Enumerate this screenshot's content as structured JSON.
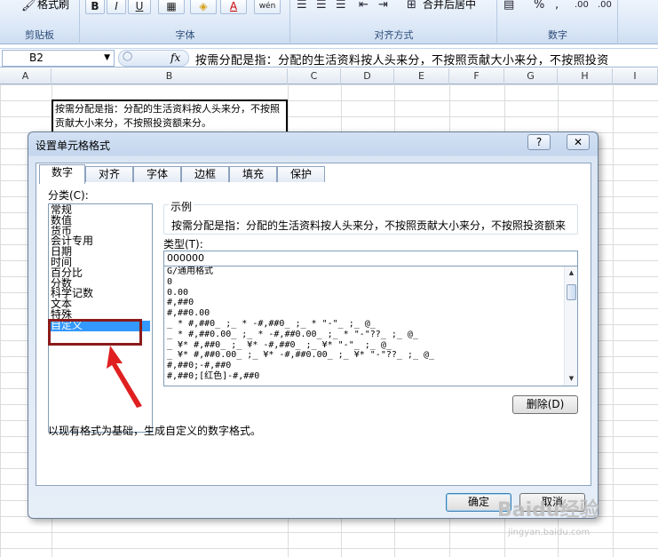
{
  "ribbon": {
    "format_painter_label": "格式刷",
    "clipboard_group": "剪贴板",
    "font_group": "字体",
    "alignment_group": "对齐方式",
    "number_group": "数字",
    "bold": "B",
    "italic": "I",
    "underline": "U",
    "merge_center": "合并后居中",
    "percent": "%",
    "comma": ",",
    "inc_decimal": ".00",
    "dec_decimal": ".00"
  },
  "formula_bar": {
    "name_box": "B2",
    "fx": "fx",
    "content": "按需分配是指：分配的生活资料按人头来分，不按照贡献大小来分，不按照投资"
  },
  "sheet": {
    "columns": [
      "A",
      "B",
      "C",
      "D",
      "E",
      "F",
      "G",
      "H",
      "I"
    ],
    "cell_b2_text": "按需分配是指：分配的生活资料按人头来分，不按照贡献大小来分，不按照投资额来分。"
  },
  "dialog": {
    "title": "设置单元格格式",
    "help": "?",
    "close": "✕",
    "tabs": [
      "数字",
      "对齐",
      "字体",
      "边框",
      "填充",
      "保护"
    ],
    "category_label": "分类(C):",
    "categories": [
      "常规",
      "数值",
      "货币",
      "会计专用",
      "日期",
      "时间",
      "百分比",
      "分数",
      "科学记数",
      "文本",
      "特殊",
      "自定义"
    ],
    "selected_category": "自定义",
    "sample_legend": "示例",
    "sample_text": "按需分配是指：分配的生活资料按人头来分，不按照贡献大小来分，不按照投资额来",
    "type_label": "类型(T):",
    "type_value": "000000",
    "formats": [
      "G/通用格式",
      "0",
      "0.00",
      "#,##0",
      "#,##0.00",
      "_ * #,##0_ ;_ * -#,##0_ ;_ * \"-\"_ ;_ @_",
      "_ * #,##0.00_ ;_ * -#,##0.00_ ;_ * \"-\"??_ ;_ @_",
      "_ ¥* #,##0_ ;_ ¥* -#,##0_ ;_ ¥* \"-\"_ ;_ @_",
      "_ ¥* #,##0.00_ ;_ ¥* -#,##0.00_ ;_ ¥* \"-\"??_ ;_ @_",
      "#,##0;-#,##0",
      "#,##0;[红色]-#,##0"
    ],
    "delete_button": "删除(D)",
    "description": "以现有格式为基础，生成自定义的数字格式。",
    "ok_button": "确定",
    "cancel_button": "取消"
  },
  "watermark": {
    "brand": "Baidu经验",
    "url": "jingyan.baidu.com"
  },
  "colors": {
    "selection": "#3399ff",
    "highlight_box": "#8b1a1a",
    "arrow": "#e02020"
  }
}
